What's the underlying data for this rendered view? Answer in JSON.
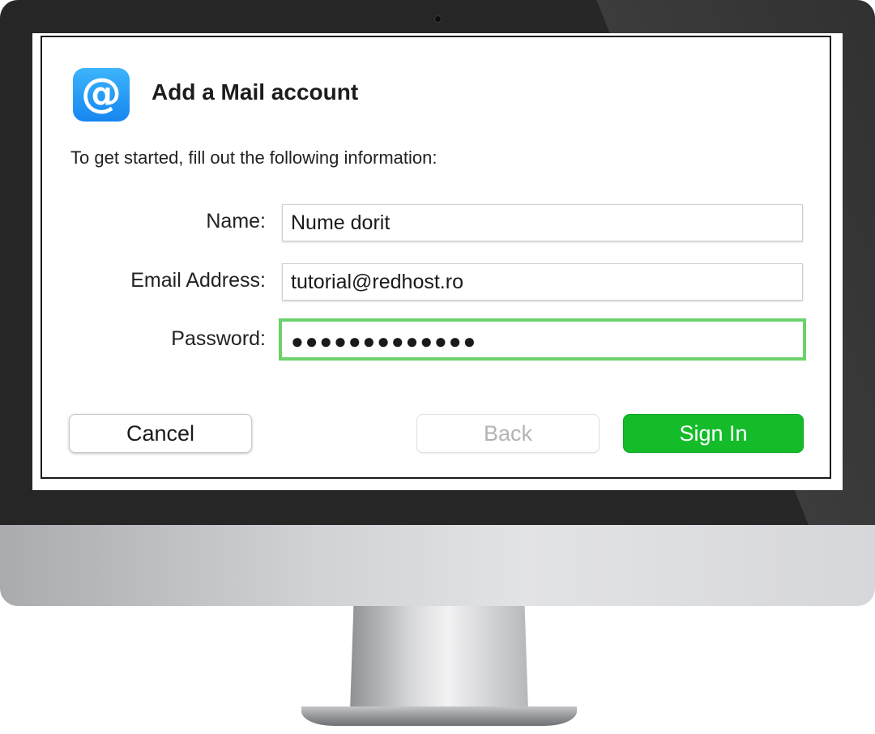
{
  "dialog": {
    "title": "Add a Mail account",
    "app_icon_glyph": "@",
    "intro": "To get started, fill out the following information:"
  },
  "form": {
    "name_label": "Name:",
    "name_value": "Nume dorit",
    "email_label": "Email Address:",
    "email_value": "tutorial@redhost.ro",
    "password_label": "Password:",
    "password_value": "●●●●●●●●●●●●●"
  },
  "buttons": {
    "cancel": "Cancel",
    "back": "Back",
    "sign_in": "Sign In"
  },
  "colors": {
    "sign_in_green": "#14bc2a",
    "focus_ring": "#6cd26a",
    "app_icon_blue": "#1686f0"
  },
  "icons": {
    "app": "mail-at-icon"
  }
}
